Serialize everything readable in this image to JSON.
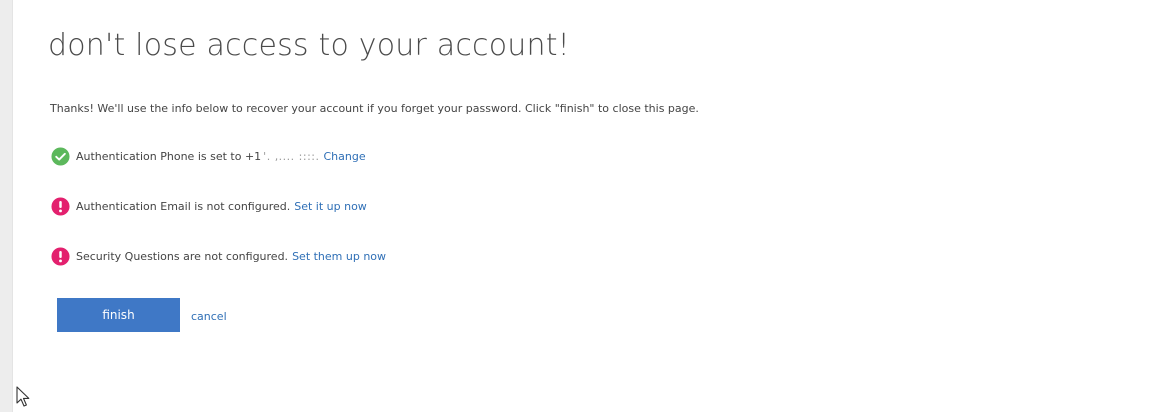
{
  "page": {
    "title": "don't lose access to your account!",
    "intro": "Thanks! We'll use the info below to recover your account if you forget your password. Click \"finish\" to close this page."
  },
  "items": [
    {
      "status": "configured",
      "icon": "check-circle-icon",
      "color": "#5cb85c",
      "text": "Authentication Phone is set to +1",
      "masked_value": "'. ,.... ::::.",
      "link": "Change"
    },
    {
      "status": "not-configured",
      "icon": "exclamation-circle-icon",
      "color": "#e3206e",
      "text": "Authentication Email is not configured.",
      "link": "Set it up now"
    },
    {
      "status": "not-configured",
      "icon": "exclamation-circle-icon",
      "color": "#e3206e",
      "text": "Security Questions are not configured.",
      "link": "Set them up now"
    }
  ],
  "actions": {
    "finish_label": "finish",
    "cancel_label": "cancel"
  },
  "colors": {
    "accent": "#3f78c6",
    "link": "#2f6fb6",
    "success": "#5cb85c",
    "error": "#e3206e"
  }
}
